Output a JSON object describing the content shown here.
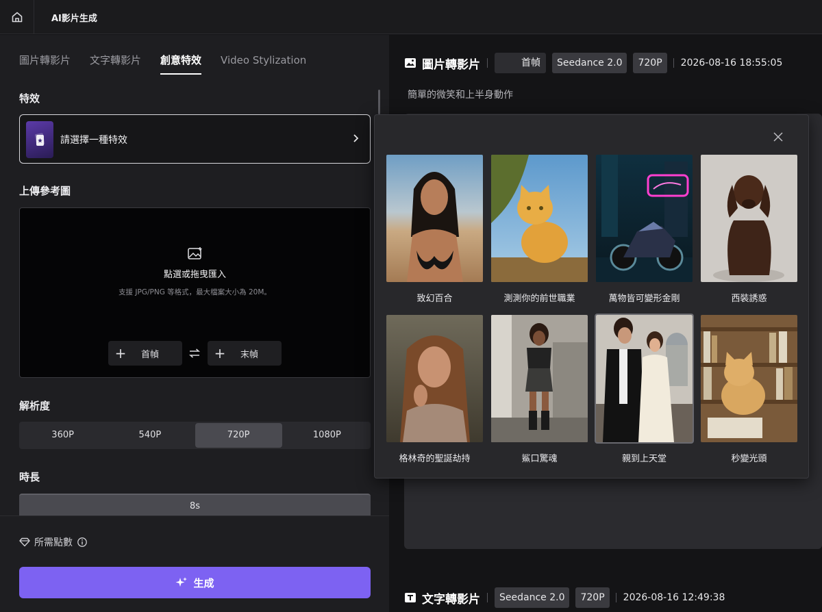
{
  "app": {
    "title": "AI影片生成"
  },
  "tabs": [
    {
      "label": "圖片轉影片",
      "active": false
    },
    {
      "label": "文字轉影片",
      "active": false
    },
    {
      "label": "創意特效",
      "active": true
    },
    {
      "label": "Video Stylization",
      "active": false
    }
  ],
  "effect": {
    "section_label": "特效",
    "placeholder": "請選擇一種特效"
  },
  "upload": {
    "section_label": "上傳參考圖",
    "title": "點選或拖曳匯入",
    "hint": "支援 JPG/PNG 等格式，最大檔案大小為 20M。",
    "first_frame": "首幀",
    "last_frame": "末幀"
  },
  "resolution": {
    "section_label": "解析度",
    "options": [
      "360P",
      "540P",
      "720P",
      "1080P"
    ],
    "selected": "720P"
  },
  "duration": {
    "section_label": "時長",
    "value": "8s"
  },
  "footer": {
    "points_label": "所需點數",
    "generate_label": "生成"
  },
  "tasks": [
    {
      "title": "圖片轉影片",
      "frame": "首幀",
      "model": "Seedance 2.0",
      "resolution": "720P",
      "timestamp": "2026-08-16 18:55:05",
      "description": "簡單的微笑和上半身動作"
    },
    {
      "title": "文字轉影片",
      "model": "Seedance 2.0",
      "resolution": "720P",
      "timestamp": "2026-08-16 12:49:38"
    }
  ],
  "effects_popup": {
    "items": [
      {
        "label": "致幻百合",
        "selected": false
      },
      {
        "label": "測測你的前世職業",
        "selected": false
      },
      {
        "label": "萬物皆可變形金剛",
        "selected": false
      },
      {
        "label": "西裝誘惑",
        "selected": false
      },
      {
        "label": "格林奇的聖誕劫持",
        "selected": false
      },
      {
        "label": "鯊口驚魂",
        "selected": false
      },
      {
        "label": "親到上天堂",
        "selected": true
      },
      {
        "label": "秒變光頭",
        "selected": false
      }
    ]
  },
  "colors": {
    "accent": "#7d62f2",
    "background": "#141416",
    "panel": "#1e1e21"
  }
}
